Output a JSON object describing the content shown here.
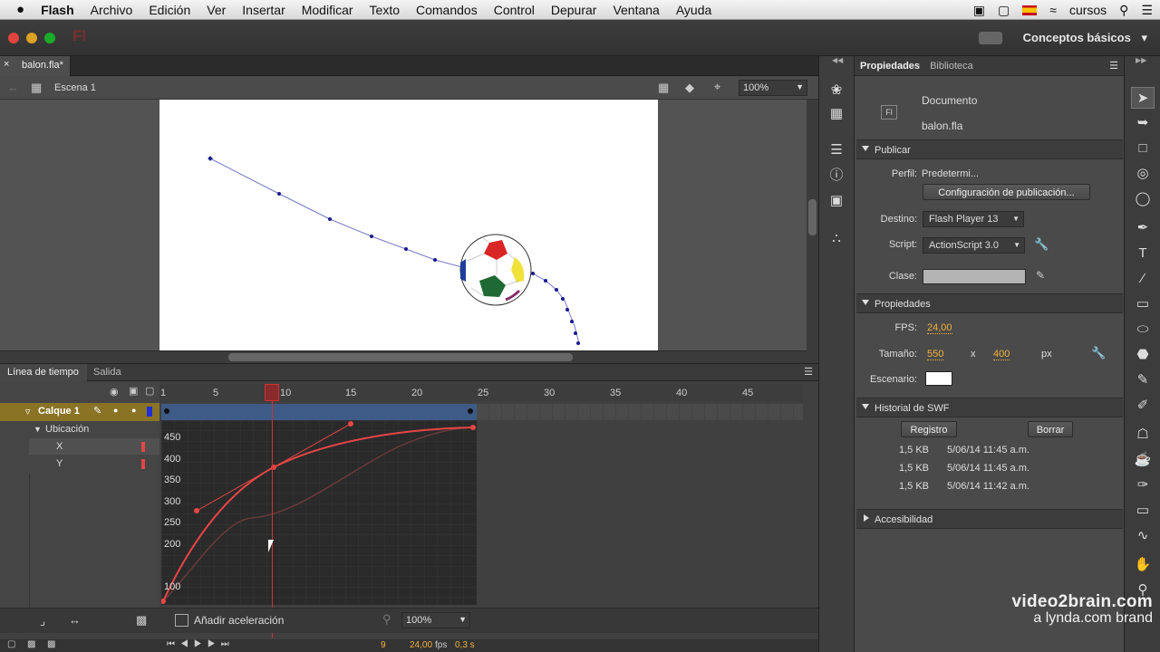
{
  "menubar": {
    "apple": "",
    "app": "Flash",
    "items": [
      "Archivo",
      "Edición",
      "Ver",
      "Insertar",
      "Modificar",
      "Texto",
      "Comandos",
      "Control",
      "Depurar",
      "Ventana",
      "Ayuda"
    ],
    "user": "cursos"
  },
  "titlebar": {
    "app_badge": "Fl",
    "workspace": "Conceptos básicos",
    "workspace_arrow": "▾"
  },
  "document": {
    "tab_name": "balon.fla*",
    "scene": "Escena 1",
    "zoom": "100%"
  },
  "timeline": {
    "tab_timeline": "Línea de tiempo",
    "tab_output": "Salida",
    "layer_name": "Calque 1",
    "group_label": "Ubicación",
    "prop_x": "X",
    "prop_y": "Y",
    "frame_labels": [
      "1",
      "5",
      "10",
      "15",
      "20",
      "25",
      "30",
      "35",
      "40",
      "45"
    ],
    "y_ticks": [
      "450",
      "400",
      "350",
      "300",
      "250",
      "200",
      "100"
    ],
    "ease_label": "Añadir aceleración",
    "graph_zoom": "100%",
    "current_frame": "9",
    "fps_readout": "24,00",
    "fps_unit": "fps",
    "time_readout": "0,3 s"
  },
  "properties": {
    "tab_props": "Propiedades",
    "tab_library": "Biblioteca",
    "doc_type": "Documento",
    "doc_name": "balon.fla",
    "doc_icon": "Fl",
    "publish": {
      "header": "Publicar",
      "profile_label": "Perfil:",
      "profile_value": "Predetermi...",
      "settings_button": "Configuración de publicación...",
      "target_label": "Destino:",
      "target_value": "Flash Player 13",
      "script_label": "Script:",
      "script_value": "ActionScript 3.0",
      "class_label": "Clase:"
    },
    "properties": {
      "header": "Propiedades",
      "fps_label": "FPS:",
      "fps_value": "24,00",
      "size_label": "Tamaño:",
      "width": "550",
      "times": "x",
      "height": "400",
      "unit": "px",
      "stage_label": "Escenario:"
    },
    "swf_history": {
      "header": "Historial de SWF",
      "log_button": "Registro",
      "clear_button": "Borrar",
      "entries": [
        {
          "size": "1,5 KB",
          "date": "5/06/14 11:45 a.m."
        },
        {
          "size": "1,5 KB",
          "date": "5/06/14 11:45 a.m."
        },
        {
          "size": "1,5 KB",
          "date": "5/06/14 11:42 a.m."
        }
      ]
    },
    "accessibility": {
      "header": "Accesibilidad"
    }
  },
  "watermark": {
    "line1": "video2brain.com",
    "line2": "a lynda.com brand"
  },
  "colors": {
    "curve": "#e84545",
    "path": "#1a1a8c",
    "accent": "#f2b23c",
    "layer_bar": "#3e5a86"
  }
}
